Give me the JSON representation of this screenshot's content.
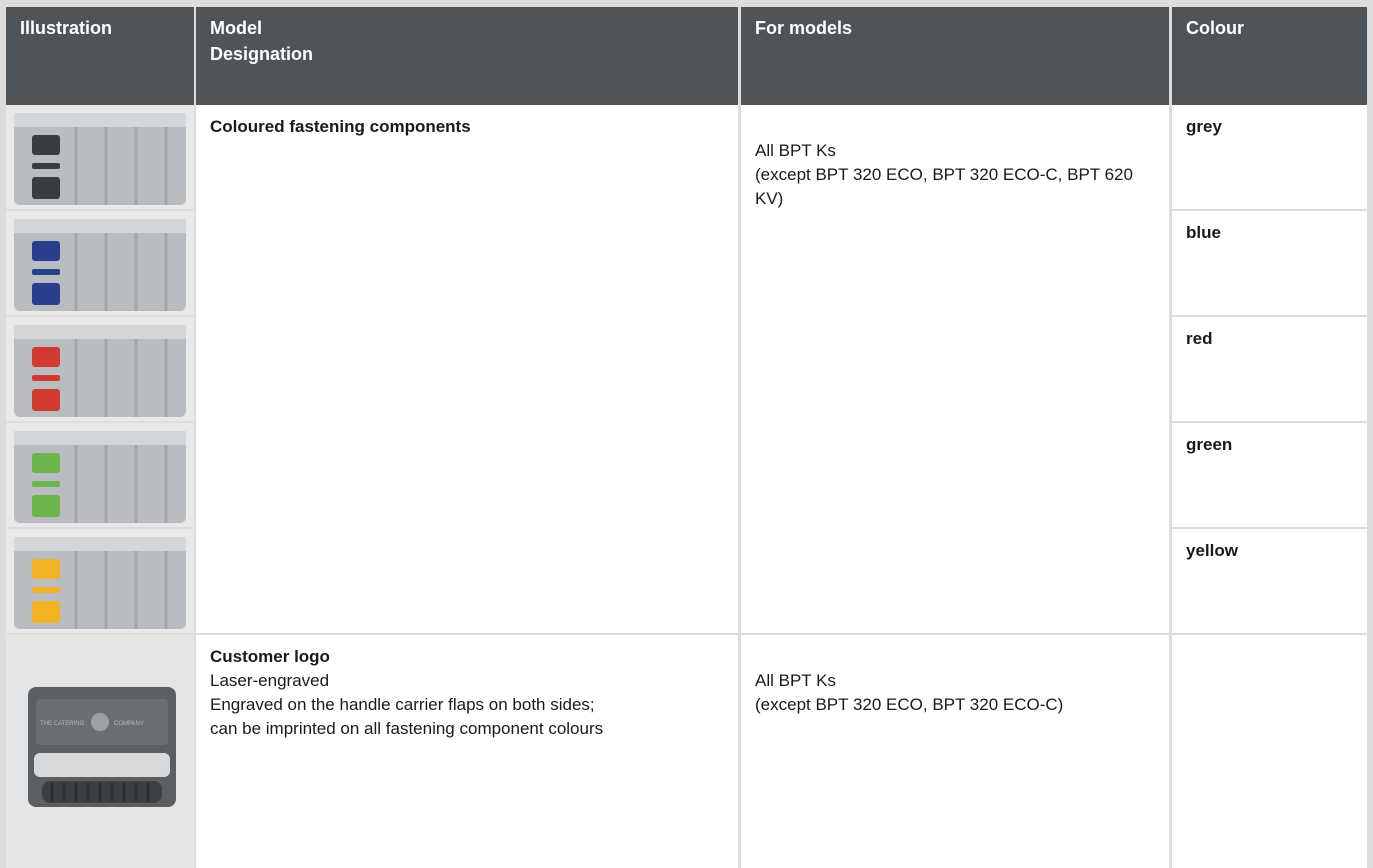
{
  "columns": {
    "illustration": "Illustration",
    "model_designation": "Model\nDesignation",
    "for_models": "For models",
    "colour": "Colour"
  },
  "rows": [
    {
      "title": "Coloured fastening components",
      "for_models": "All BPT Ks\n(except BPT 320 ECO, BPT 320 ECO-C, BPT 620 KV)",
      "variants": [
        {
          "colour": "grey",
          "swatch": "#3a3d40",
          "image_icon": "food-carrier-grey-icon"
        },
        {
          "colour": "blue",
          "swatch": "#2a3f8c",
          "image_icon": "food-carrier-blue-icon"
        },
        {
          "colour": "red",
          "swatch": "#d33a34",
          "image_icon": "food-carrier-red-icon"
        },
        {
          "colour": "green",
          "swatch": "#6db54a",
          "image_icon": "food-carrier-green-icon"
        },
        {
          "colour": "yellow",
          "swatch": "#f0b323",
          "image_icon": "food-carrier-yellow-icon"
        }
      ]
    },
    {
      "title": "Customer logo",
      "lines": [
        "Laser-engraved",
        "Engraved on the handle carrier flaps on both sides;",
        "can be imprinted on all fastening component colours"
      ],
      "for_models": "All BPT Ks\n(except BPT 320 ECO, BPT 320 ECO-C)",
      "image_icon": "engraved-handle-logo-icon",
      "logo_text_left": "THE CATERING",
      "logo_text_right": "COMPANY"
    }
  ]
}
